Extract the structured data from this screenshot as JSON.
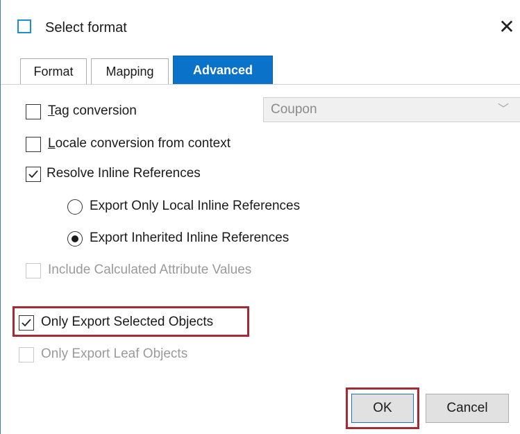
{
  "window": {
    "title": "Select format",
    "close_glyph": "✕"
  },
  "tabs": [
    {
      "label": "Format",
      "active": false
    },
    {
      "label": "Mapping",
      "active": false
    },
    {
      "label": "Advanced",
      "active": true
    }
  ],
  "options": {
    "tag_conversion": {
      "mnemonic": "T",
      "rest": "ag conversion",
      "checked": false,
      "enabled": true
    },
    "tag_combo": {
      "value": "Coupon",
      "enabled": false
    },
    "locale_conversion": {
      "mnemonic": "L",
      "rest": "ocale conversion from context",
      "checked": false,
      "enabled": true
    },
    "resolve_inline": {
      "label": "Resolve Inline References",
      "checked": true,
      "enabled": true
    },
    "export_local": {
      "label": "Export Only Local Inline References",
      "selected": false
    },
    "export_inherited": {
      "label": "Export Inherited Inline References",
      "selected": true
    },
    "include_calculated": {
      "label": "Include Calculated Attribute Values",
      "checked": false,
      "enabled": false
    },
    "only_selected": {
      "label": "Only Export Selected Objects",
      "checked": true,
      "enabled": true
    },
    "only_leaf": {
      "label": "Only Export Leaf Objects",
      "checked": false,
      "enabled": false
    }
  },
  "buttons": {
    "ok": "OK",
    "cancel": "Cancel"
  },
  "colors": {
    "accent": "#0a73c9",
    "highlight": "#a52a33"
  }
}
